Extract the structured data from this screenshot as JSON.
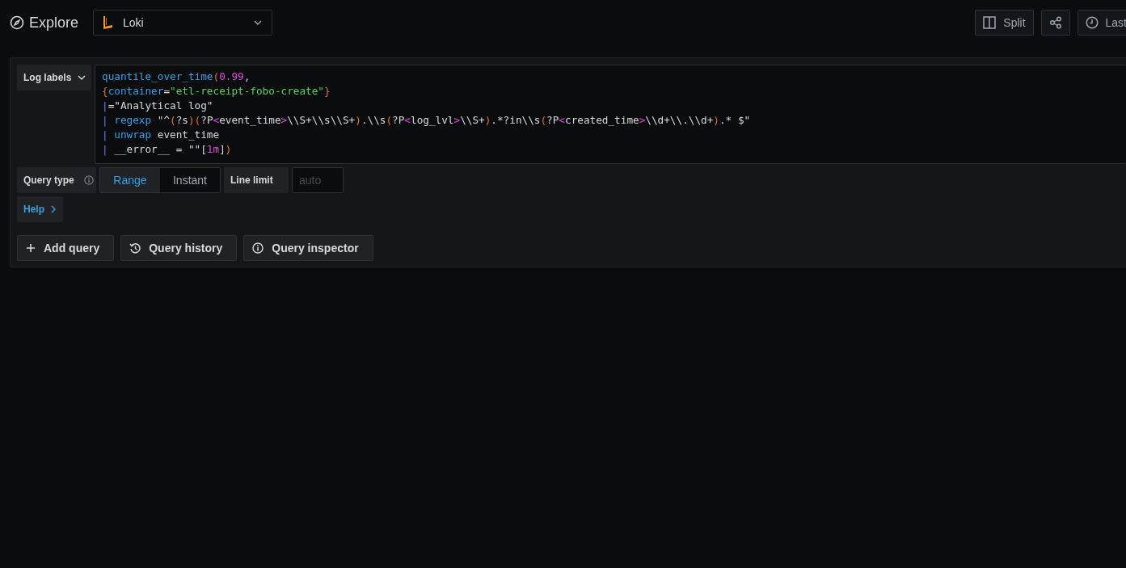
{
  "header": {
    "title": "Explore",
    "datasource": {
      "name": "Loki"
    },
    "actions": [
      {
        "kind": "split",
        "label": "Split"
      },
      {
        "kind": "share"
      },
      {
        "kind": "time",
        "label": "Last"
      }
    ]
  },
  "query": {
    "labels_button": "Log labels",
    "lines": [
      [
        {
          "kind": "func",
          "text": "quantile_over_time"
        },
        {
          "kind": "paren",
          "text": "("
        },
        {
          "kind": "number",
          "text": "0.99"
        },
        {
          "kind": "text",
          "text": ","
        }
      ],
      [
        {
          "kind": "paren",
          "text": "{"
        },
        {
          "kind": "func",
          "text": "container"
        },
        {
          "kind": "text",
          "text": "="
        },
        {
          "kind": "string",
          "text": "\"etl-receipt-fobo-create\""
        },
        {
          "kind": "paren",
          "text": "}"
        }
      ],
      [
        {
          "kind": "pipe",
          "text": "|"
        },
        {
          "kind": "text",
          "text": "=\"Analytical log\""
        }
      ],
      [
        {
          "kind": "pipe",
          "text": "| "
        },
        {
          "kind": "func",
          "text": "regexp"
        },
        {
          "kind": "text",
          "text": " \"^"
        },
        {
          "kind": "paren",
          "text": "("
        },
        {
          "kind": "text",
          "text": "?s"
        },
        {
          "kind": "paren",
          "text": ")("
        },
        {
          "kind": "text",
          "text": "?P"
        },
        {
          "kind": "angle",
          "text": "<"
        },
        {
          "kind": "text",
          "text": "event_time"
        },
        {
          "kind": "angle",
          "text": ">"
        },
        {
          "kind": "text",
          "text": "\\\\S+\\\\s\\\\S+"
        },
        {
          "kind": "paren",
          "text": ")"
        },
        {
          "kind": "text",
          "text": ".\\\\s"
        },
        {
          "kind": "paren",
          "text": "("
        },
        {
          "kind": "text",
          "text": "?P"
        },
        {
          "kind": "angle",
          "text": "<"
        },
        {
          "kind": "text",
          "text": "log_lvl"
        },
        {
          "kind": "angle",
          "text": ">"
        },
        {
          "kind": "text",
          "text": "\\\\S+"
        },
        {
          "kind": "paren",
          "text": ")"
        },
        {
          "kind": "text",
          "text": ".*?in\\\\s"
        },
        {
          "kind": "paren",
          "text": "("
        },
        {
          "kind": "text",
          "text": "?P"
        },
        {
          "kind": "angle",
          "text": "<"
        },
        {
          "kind": "text",
          "text": "created_time"
        },
        {
          "kind": "angle",
          "text": ">"
        },
        {
          "kind": "text",
          "text": "\\\\d+\\\\.\\\\d+"
        },
        {
          "kind": "paren",
          "text": ")"
        },
        {
          "kind": "text",
          "text": ".* $\""
        }
      ],
      [
        {
          "kind": "pipe",
          "text": "| "
        },
        {
          "kind": "func",
          "text": "unwrap"
        },
        {
          "kind": "text",
          "text": " event_time"
        }
      ],
      [
        {
          "kind": "pipe",
          "text": "|"
        },
        {
          "kind": "text",
          "text": " __error__ = \"\"["
        },
        {
          "kind": "number",
          "text": "1m"
        },
        {
          "kind": "text",
          "text": "]"
        },
        {
          "kind": "paren",
          "text": ")"
        }
      ]
    ],
    "query_type": {
      "label": "Query type",
      "options": [
        {
          "label": "Range",
          "selected": true
        },
        {
          "label": "Instant",
          "selected": false
        }
      ]
    },
    "line_limit": {
      "label": "Line limit",
      "placeholder": "auto"
    },
    "help": "Help",
    "buttons": [
      {
        "kind": "add",
        "label": "Add query"
      },
      {
        "kind": "history",
        "label": "Query history"
      },
      {
        "kind": "inspector",
        "label": "Query inspector"
      }
    ]
  }
}
